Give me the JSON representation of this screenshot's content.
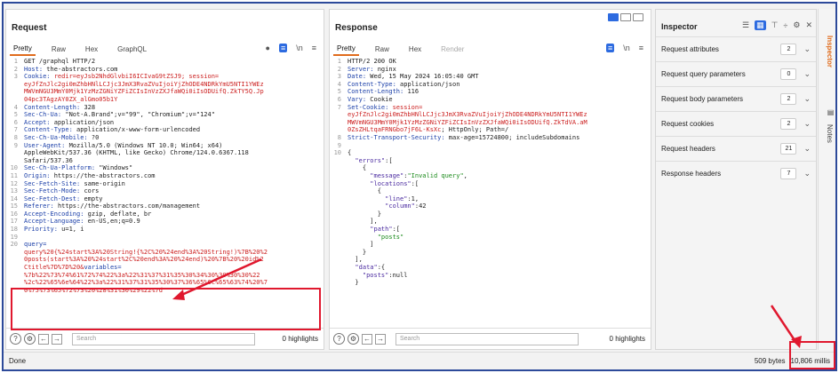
{
  "request": {
    "title": "Request",
    "tabs": [
      "Pretty",
      "Raw",
      "Hex",
      "GraphQL"
    ],
    "lines": [
      {
        "n": "1",
        "t": [
          [
            "GET /graphql HTTP/2",
            ""
          ]
        ]
      },
      {
        "n": "2",
        "t": [
          [
            "Host: ",
            "key"
          ],
          [
            "the-abstractors.com",
            ""
          ]
        ]
      },
      {
        "n": "3",
        "t": [
          [
            "Cookie: ",
            "key"
          ],
          [
            "redir=eyJsb2NhdGlvbiI6ICIvaG9tZSJ9; session=",
            "hv"
          ]
        ]
      },
      {
        "n": "",
        "t": [
          [
            "eyJfZnJlc2gi0mZhbHNlLCJjc3JmX3RvaZVuIjoiYjZhODE4NDRkYmU5NTI1YWEz",
            "hv"
          ]
        ]
      },
      {
        "n": "",
        "t": [
          [
            "MWVmNGU3MmY0Mjk1YzMzZGNiYZFiZCIsInVzZXJfaWQi0iIsODUifQ.ZkTY5Q.Jp",
            "hv"
          ]
        ]
      },
      {
        "n": "",
        "t": [
          [
            "04pc3TAgzAY0ZX_alGmo05b1Y",
            "hv"
          ]
        ]
      },
      {
        "n": "4",
        "t": [
          [
            "Content-Length: ",
            "key"
          ],
          [
            "328",
            ""
          ]
        ]
      },
      {
        "n": "5",
        "t": [
          [
            "Sec-Ch-Ua: ",
            "key"
          ],
          [
            "\"Not-A.Brand\";v=\"99\", \"Chromium\";v=\"124\"",
            ""
          ]
        ]
      },
      {
        "n": "6",
        "t": [
          [
            "Accept: ",
            "key"
          ],
          [
            "application/json",
            ""
          ]
        ]
      },
      {
        "n": "7",
        "t": [
          [
            "Content-Type: ",
            "key"
          ],
          [
            "application/x-www-form-urlencoded",
            ""
          ]
        ]
      },
      {
        "n": "8",
        "t": [
          [
            "Sec-Ch-Ua-Mobile: ",
            "key"
          ],
          [
            "?0",
            ""
          ]
        ]
      },
      {
        "n": "9",
        "t": [
          [
            "User-Agent: ",
            "key"
          ],
          [
            "Mozilla/5.0 (Windows NT 10.0; Win64; x64)",
            ""
          ]
        ]
      },
      {
        "n": "",
        "t": [
          [
            "AppleWebKit/537.36 (KHTML, like Gecko) Chrome/124.0.6367.118",
            ""
          ]
        ]
      },
      {
        "n": "",
        "t": [
          [
            "Safari/537.36",
            ""
          ]
        ]
      },
      {
        "n": "10",
        "t": [
          [
            "Sec-Ch-Ua-Platform: ",
            "key"
          ],
          [
            "\"Windows\"",
            ""
          ]
        ]
      },
      {
        "n": "11",
        "t": [
          [
            "Origin: ",
            "key"
          ],
          [
            "https://the-abstractors.com",
            ""
          ]
        ]
      },
      {
        "n": "12",
        "t": [
          [
            "Sec-Fetch-Site: ",
            "key"
          ],
          [
            "same-origin",
            ""
          ]
        ]
      },
      {
        "n": "13",
        "t": [
          [
            "Sec-Fetch-Mode: ",
            "key"
          ],
          [
            "cors",
            ""
          ]
        ]
      },
      {
        "n": "14",
        "t": [
          [
            "Sec-Fetch-Dest: ",
            "key"
          ],
          [
            "empty",
            ""
          ]
        ]
      },
      {
        "n": "15",
        "t": [
          [
            "Referer: ",
            "key"
          ],
          [
            "https://the-abstractors.com/management",
            ""
          ]
        ]
      },
      {
        "n": "16",
        "t": [
          [
            "Accept-Encoding: ",
            "key"
          ],
          [
            "gzip, deflate, br",
            ""
          ]
        ]
      },
      {
        "n": "17",
        "t": [
          [
            "Accept-Language: ",
            "key"
          ],
          [
            "en-US,en;q=0.9",
            ""
          ]
        ]
      },
      {
        "n": "18",
        "t": [
          [
            "Priority: ",
            "key"
          ],
          [
            "u=1, i",
            ""
          ]
        ]
      },
      {
        "n": "19",
        "t": [
          [
            "",
            ""
          ]
        ]
      },
      {
        "n": "20",
        "t": [
          [
            "query=",
            "key"
          ]
        ]
      },
      {
        "n": "",
        "t": [
          [
            "query%20{%24start%3A%20String!{%2C%20%24end%3A%20String!)%7B%20%2",
            "hv"
          ]
        ]
      },
      {
        "n": "",
        "t": [
          [
            "0posts(start%3A%20%24start%2C%20end%3A%20%24end)%20%7B%20%20id%2",
            "hv"
          ]
        ]
      },
      {
        "n": "",
        "t": [
          [
            "Ctitle%7D%7D%20&",
            "hv"
          ],
          [
            "variables=",
            "key"
          ]
        ]
      },
      {
        "n": "",
        "t": [
          [
            "%7b%22%73%74%61%72%74%22%3a%22%31%37%31%35%30%34%30%30%30%30%22",
            "hv"
          ]
        ]
      },
      {
        "n": "",
        "t": [
          [
            "%2c%22%65%6e%64%22%3a%22%31%37%31%35%30%37%36%65%6c%65%63%74%20%7",
            "hv"
          ]
        ]
      },
      {
        "n": "",
        "t": [
          [
            "0%75%73%65%72%73%20%28%31%30%29%22%7d",
            "hv"
          ]
        ]
      }
    ],
    "search_placeholder": "Search",
    "highlights": "0 highlights"
  },
  "response": {
    "title": "Response",
    "tabs": [
      "Pretty",
      "Raw",
      "Hex",
      "Render"
    ],
    "lines": [
      {
        "n": "1",
        "t": [
          [
            "HTTP/2 200 OK",
            ""
          ]
        ]
      },
      {
        "n": "2",
        "t": [
          [
            "Server: ",
            "key"
          ],
          [
            "nginx",
            ""
          ]
        ]
      },
      {
        "n": "3",
        "t": [
          [
            "Date: ",
            "key"
          ],
          [
            "Wed, 15 May 2024 16:05:40 GMT",
            ""
          ]
        ]
      },
      {
        "n": "4",
        "t": [
          [
            "Content-Type: ",
            "key"
          ],
          [
            "application/json",
            ""
          ]
        ]
      },
      {
        "n": "5",
        "t": [
          [
            "Content-Length: ",
            "key"
          ],
          [
            "116",
            ""
          ]
        ]
      },
      {
        "n": "6",
        "t": [
          [
            "Vary: ",
            "key"
          ],
          [
            "Cookie",
            ""
          ]
        ]
      },
      {
        "n": "7",
        "t": [
          [
            "Set-Cookie: ",
            "key"
          ],
          [
            "session=",
            "hv"
          ]
        ]
      },
      {
        "n": "",
        "t": [
          [
            "eyJfZnJlc2gi0mZhbHNlLCJjc3JmX3RvaZVuIjoiYjZhODE4NDRkYmU5NTI1YWEz",
            "hv"
          ]
        ]
      },
      {
        "n": "",
        "t": [
          [
            "MWVmNGU3MmY0Mjk1YzMzZGNiYZFiZCIsInVzZXJfaWQi0iIsODUifQ.ZkTdVA.aM",
            "hv"
          ]
        ]
      },
      {
        "n": "",
        "t": [
          [
            "0ZsZHLtqaFRNGbo7jF6L-KsXc",
            "hv"
          ],
          [
            "; HttpOnly; Path=/",
            ""
          ]
        ]
      },
      {
        "n": "8",
        "t": [
          [
            "Strict-Transport-Security: ",
            "key"
          ],
          [
            "max-age=15724800; includeSubdomains",
            ""
          ]
        ]
      },
      {
        "n": "9",
        "t": [
          [
            "",
            ""
          ]
        ]
      },
      {
        "n": "10",
        "t": [
          [
            "{",
            ""
          ]
        ]
      },
      {
        "n": "",
        "t": [
          [
            "  \"errors\"",
            "jkey"
          ],
          [
            ":[",
            ""
          ]
        ]
      },
      {
        "n": "",
        "t": [
          [
            "    {",
            ""
          ]
        ]
      },
      {
        "n": "",
        "t": [
          [
            "      \"message\"",
            "jkey"
          ],
          [
            ":",
            ""
          ],
          [
            "\"Invalid query\"",
            "jstr"
          ],
          [
            ",",
            ""
          ]
        ]
      },
      {
        "n": "",
        "t": [
          [
            "      \"locations\"",
            "jkey"
          ],
          [
            ":[",
            ""
          ]
        ]
      },
      {
        "n": "",
        "t": [
          [
            "        {",
            ""
          ]
        ]
      },
      {
        "n": "",
        "t": [
          [
            "          \"line\"",
            "jkey"
          ],
          [
            ":1,",
            ""
          ]
        ]
      },
      {
        "n": "",
        "t": [
          [
            "          \"column\"",
            "jkey"
          ],
          [
            ":42",
            ""
          ]
        ]
      },
      {
        "n": "",
        "t": [
          [
            "        }",
            ""
          ]
        ]
      },
      {
        "n": "",
        "t": [
          [
            "      ],",
            ""
          ]
        ]
      },
      {
        "n": "",
        "t": [
          [
            "      \"path\"",
            "jkey"
          ],
          [
            ":[",
            ""
          ]
        ]
      },
      {
        "n": "",
        "t": [
          [
            "        \"posts\"",
            "jstr"
          ]
        ]
      },
      {
        "n": "",
        "t": [
          [
            "      ]",
            ""
          ]
        ]
      },
      {
        "n": "",
        "t": [
          [
            "    }",
            ""
          ]
        ]
      },
      {
        "n": "",
        "t": [
          [
            "  ],",
            ""
          ]
        ]
      },
      {
        "n": "",
        "t": [
          [
            "  \"data\"",
            "jkey"
          ],
          [
            ":{",
            ""
          ]
        ]
      },
      {
        "n": "",
        "t": [
          [
            "    \"posts\"",
            "jkey"
          ],
          [
            ":null",
            ""
          ]
        ]
      },
      {
        "n": "",
        "t": [
          [
            "  }",
            ""
          ]
        ]
      }
    ],
    "search_placeholder": "Search",
    "highlights": "0 highlights"
  },
  "inspector": {
    "title": "Inspector",
    "sections": [
      {
        "label": "Request attributes",
        "count": "2"
      },
      {
        "label": "Request query parameters",
        "count": "0"
      },
      {
        "label": "Request body parameters",
        "count": "2"
      },
      {
        "label": "Request cookies",
        "count": "2"
      },
      {
        "label": "Request headers",
        "count": "21"
      },
      {
        "label": "Response headers",
        "count": "7"
      }
    ]
  },
  "side_tabs": [
    "Inspector",
    "Notes"
  ],
  "status": {
    "left": "Done",
    "bytes": "509 bytes",
    "millis": "10,806 millis"
  },
  "icons": {
    "help": "?",
    "settings": "⚙",
    "back": "←",
    "forward": "→",
    "wrap": "\\n",
    "menu": "≡",
    "chevron": "⌄",
    "close": "✕"
  }
}
